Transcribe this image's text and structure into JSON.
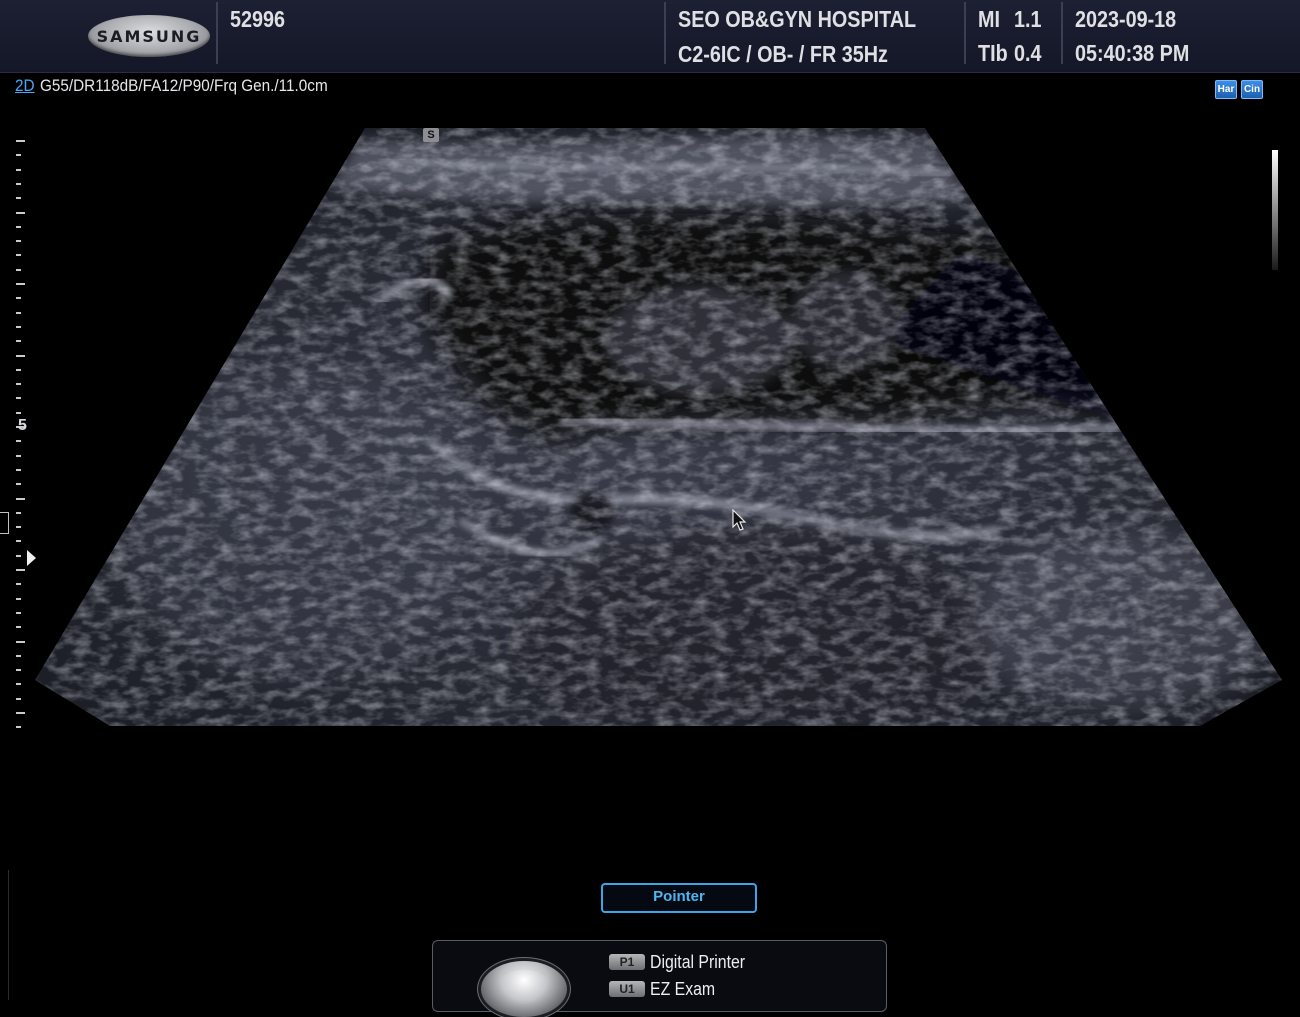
{
  "header": {
    "brand": "SAMSUNG",
    "patient_id": "52996",
    "hospital": "SEO OB&GYN HOSPITAL",
    "probe_info": "C2-6IC / OB- / FR 35Hz",
    "mi_label": "MI",
    "mi_value": "1.1",
    "tib_label": "TIb",
    "tib_value": "0.4",
    "date": "2023-09-18",
    "time": "05:40:38 PM"
  },
  "status": {
    "mode": "2D",
    "params": "G55/DR118dB/FA12/P90/Frq Gen./11.0cm",
    "mode_buttons": [
      "Har",
      "Cin"
    ]
  },
  "scale": {
    "label": "5"
  },
  "image": {
    "orientation_marker": "S"
  },
  "controls": {
    "pointer_label": "Pointer",
    "keys": [
      {
        "key": "P1",
        "label": "Digital Printer"
      },
      {
        "key": "U1",
        "label": "EZ Exam"
      }
    ]
  }
}
